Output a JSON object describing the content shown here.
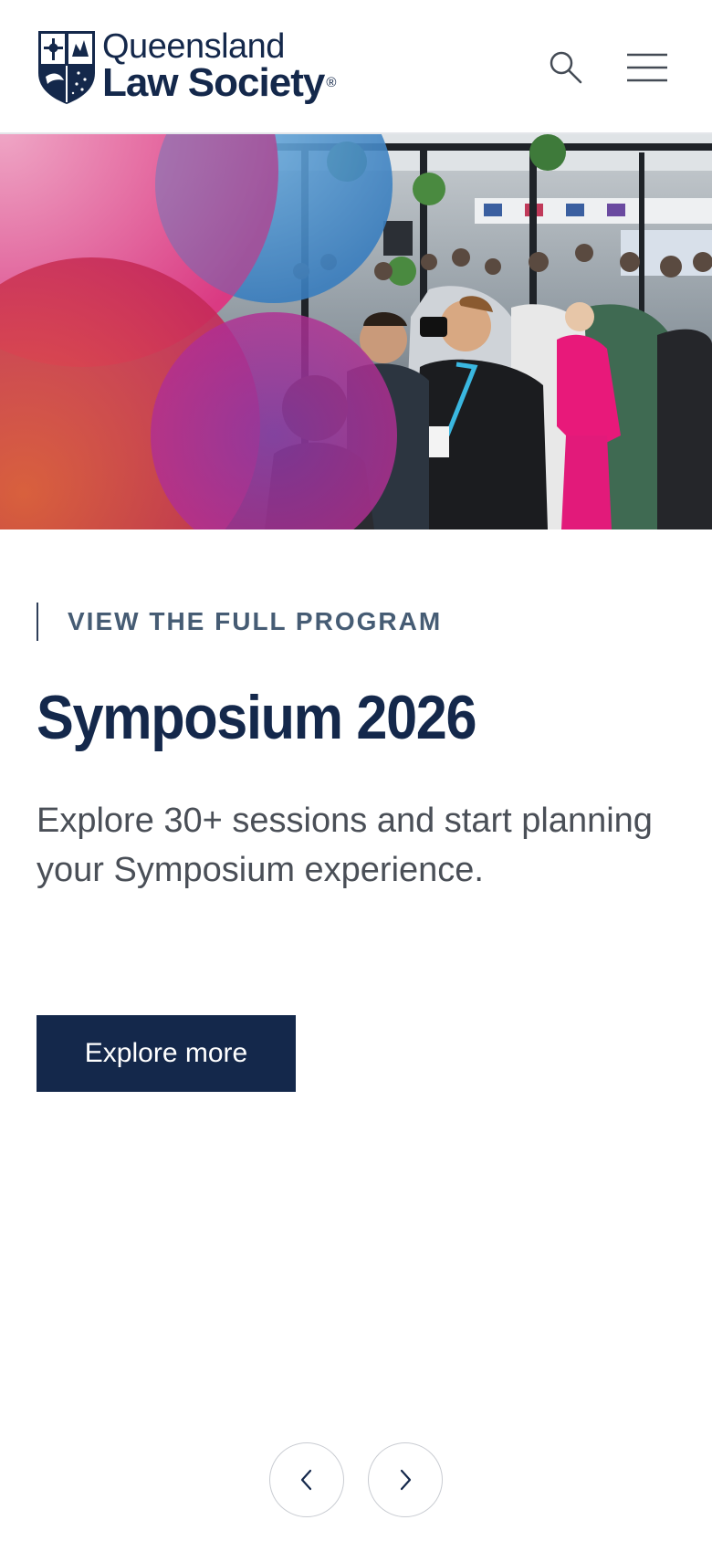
{
  "header": {
    "logo": {
      "line1": "Queensland",
      "line2": "Law Society",
      "registered_mark": "®"
    },
    "search_icon": "search-icon",
    "menu_icon": "hamburger-menu-icon"
  },
  "hero": {
    "image": "conference-crowd-photo",
    "colors": {
      "pink": "#e0317f",
      "blue": "#3a86c8",
      "magenta": "#b0288c",
      "orange": "#e4643a"
    }
  },
  "content": {
    "eyebrow": "VIEW THE FULL PROGRAM",
    "title": "Symposium 2026",
    "description": "Explore 30+ sessions and start planning your Symposium experience.",
    "cta_label": "Explore more"
  },
  "carousel": {
    "prev_icon": "chevron-left-icon",
    "next_icon": "chevron-right-icon"
  },
  "colors": {
    "brand_navy": "#14284b",
    "eyebrow_text": "#465c74",
    "body_text": "#4a4f57"
  }
}
